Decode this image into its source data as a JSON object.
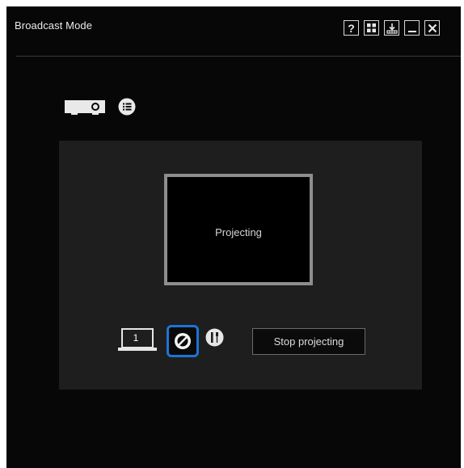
{
  "window": {
    "title": "Broadcast Mode",
    "buttons": [
      {
        "name": "help",
        "label": "?",
        "icon": "question-icon"
      },
      {
        "name": "grid",
        "icon": "grid-icon"
      },
      {
        "name": "download",
        "icon": "download-icon"
      },
      {
        "name": "minimize",
        "icon": "minimize-icon"
      },
      {
        "name": "close",
        "icon": "close-icon"
      }
    ]
  },
  "device": {
    "icon": "projector-icon",
    "menu_icon": "list-icon"
  },
  "preview": {
    "status_text": "Projecting"
  },
  "controls": {
    "display_number": "1",
    "stop_label": "Stop projecting",
    "block_icon": "no-entry-icon",
    "tools_icon": "tools-icon"
  },
  "colors": {
    "window_bg": "#070707",
    "panel_bg": "#1e1e1e",
    "accent": "#1d74d6"
  }
}
